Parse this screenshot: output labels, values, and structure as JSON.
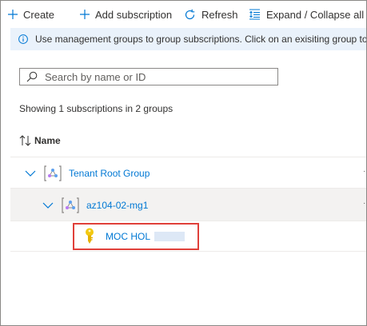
{
  "toolbar": {
    "create_label": "Create",
    "add_subscription_label": "Add subscription",
    "refresh_label": "Refresh",
    "expand_collapse_label": "Expand / Collapse all"
  },
  "info_banner": {
    "text": "Use management groups to group subscriptions. Click on an exisiting group to drill in,"
  },
  "search": {
    "placeholder": "Search by name or ID",
    "value": ""
  },
  "summary_text": "Showing 1 subscriptions in 2 groups",
  "columns": {
    "name_label": "Name"
  },
  "tree": {
    "root": {
      "label": "Tenant Root Group",
      "expanded": true
    },
    "group": {
      "label": "az104-02-mg1",
      "expanded": true
    },
    "subscription": {
      "label": "MOC HOL"
    }
  },
  "colors": {
    "accent": "#0078d4",
    "info_bg": "#eaf2fb",
    "highlight_border": "#e0403a",
    "key_icon": "#f2c811"
  },
  "icons": {
    "create": "plus-icon",
    "add_subscription": "plus-icon",
    "refresh": "refresh-icon",
    "expand_collapse": "expand-collapse-icon",
    "info": "info-icon",
    "search": "search-icon",
    "sort": "sort-icon",
    "management_group": "management-group-icon",
    "subscription": "key-icon"
  }
}
